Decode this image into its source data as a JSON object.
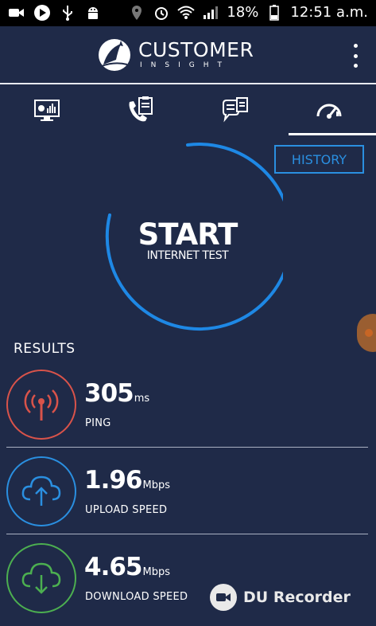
{
  "status_bar": {
    "icons_left": [
      "video-camera-icon",
      "play-icon",
      "usb-icon",
      "android-icon"
    ],
    "icons_right": [
      "location-icon",
      "alarm-icon",
      "wifi-icon",
      "signal-icon"
    ],
    "battery": "18%",
    "time": "12:51 a.m."
  },
  "header": {
    "logo_main": "CUSTOMER",
    "logo_sub": "INSIGHT",
    "menu_icon": "more-vertical-icon"
  },
  "tabs": [
    {
      "icon": "dashboard-chart-icon",
      "active": false
    },
    {
      "icon": "phone-clipboard-icon",
      "active": false
    },
    {
      "icon": "chat-clipboard-icon",
      "active": false
    },
    {
      "icon": "speedometer-icon",
      "active": true
    }
  ],
  "history_button": "HISTORY",
  "start": {
    "title": "START",
    "subtitle": "INTERNET TEST"
  },
  "results": {
    "title": "RESULTS",
    "items": [
      {
        "value": "305",
        "unit": "ms",
        "label": "PING",
        "color": "#d9534a",
        "icon": "antenna-icon"
      },
      {
        "value": "1.96",
        "unit": "Mbps",
        "label": "UPLOAD SPEED",
        "color": "#2a8fe0",
        "icon": "cloud-upload-icon"
      },
      {
        "value": "4.65",
        "unit": "Mbps",
        "label": "DOWNLOAD SPEED",
        "color": "#4caf50",
        "icon": "cloud-download-icon"
      }
    ]
  },
  "watermark": "DU Recorder",
  "colors": {
    "background": "#1f2a48",
    "accent": "#2a8fe0"
  }
}
